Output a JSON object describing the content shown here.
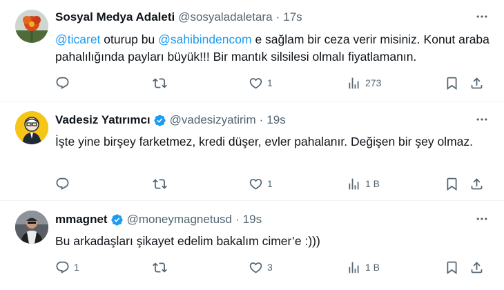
{
  "tweets": [
    {
      "name": "Sosyal Medya Adaleti",
      "verified": false,
      "handle": "@sosyaladaletara",
      "dot": "·",
      "time": "17s",
      "mention1": "@ticaret",
      "text_a": " oturup bu ",
      "mention2": "@sahibindencom",
      "text_b": " e sağlam bir ceza verir misiniz. Konut araba pahalılığında payları büyük!!! Bir mantık silsilesi olmalı fiyatlamanın.",
      "replies": "",
      "retweets": "",
      "likes": "1",
      "views": "273"
    },
    {
      "name": "Vadesiz Yatırımcı",
      "verified": true,
      "handle": "@vadesizyatirim",
      "dot": "·",
      "time": "19s",
      "text": "İşte yine birşey farketmez, kredi düşer, evler pahalanır. Değişen bir şey olmaz.",
      "replies": "",
      "retweets": "",
      "likes": "1",
      "views": "1 B"
    },
    {
      "name": "mmagnet",
      "verified": true,
      "handle": "@moneymagnetusd",
      "dot": "·",
      "time": "19s",
      "text": "Bu arkadaşları şikayet edelim bakalım cimer’e :)))",
      "replies": "1",
      "retweets": "",
      "likes": "3",
      "views": "1 B"
    }
  ],
  "icons": {
    "reply": "reply-icon",
    "retweet": "retweet-icon",
    "like": "like-icon",
    "views": "views-icon",
    "bookmark": "bookmark-icon",
    "share": "share-icon",
    "more": "more-icon",
    "verified": "verified-badge-icon"
  },
  "colors": {
    "link": "#1d9bf0",
    "secondary_text": "#536471",
    "verified_badge": "#1d9bf0"
  }
}
